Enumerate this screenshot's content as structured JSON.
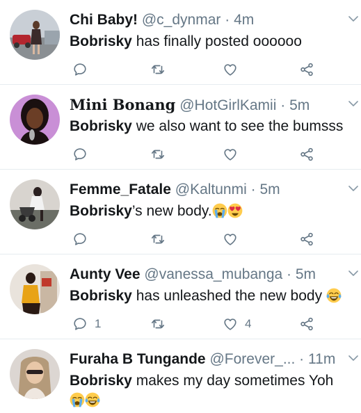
{
  "tweets": [
    {
      "name": "Chi Baby!",
      "handle": "@c_dynmar",
      "sep": "·",
      "time": "4m",
      "mention": "Bobrisky",
      "text": " has finally posted oooooo",
      "reply_count": "",
      "like_count": ""
    },
    {
      "name": "Mini Bonang",
      "handle": "@HotGirlKamii",
      "sep": "·",
      "time": "5m",
      "mention": "Bobrisky",
      "text": " we also want to see the bumsss",
      "reply_count": "",
      "like_count": ""
    },
    {
      "name": "Femme_Fatale",
      "handle": "@Kaltunmi",
      "sep": "·",
      "time": "5m",
      "mention": "Bobrisky",
      "text": "’s new body.",
      "emojis": [
        "loudly-crying-face-emoji",
        "heart-eyes-emoji"
      ],
      "reply_count": "",
      "like_count": ""
    },
    {
      "name": "Aunty Vee",
      "handle": "@vanessa_mubanga",
      "sep": "·",
      "time": "5m",
      "mention": "Bobrisky",
      "text": " has unleashed the new body",
      "emojis": [
        "tears-of-joy-emoji"
      ],
      "reply_count": "1",
      "like_count": "4"
    },
    {
      "name": "Furaha B Tungande",
      "handle": "@Forever_...",
      "sep": "·",
      "time": "11m",
      "mention": "Bobrisky",
      "text": " makes my day sometimes Yoh",
      "emojis": [
        "loudly-crying-face-emoji",
        "tears-of-joy-emoji"
      ]
    }
  ],
  "colors": {
    "text": "#14171a",
    "secondary": "#657786",
    "divider": "#e6ecf0",
    "emoji_yellow": "#ffcc4d"
  },
  "icons": [
    "reply-icon",
    "retweet-icon",
    "like-icon",
    "share-icon",
    "chevron-down-icon"
  ]
}
